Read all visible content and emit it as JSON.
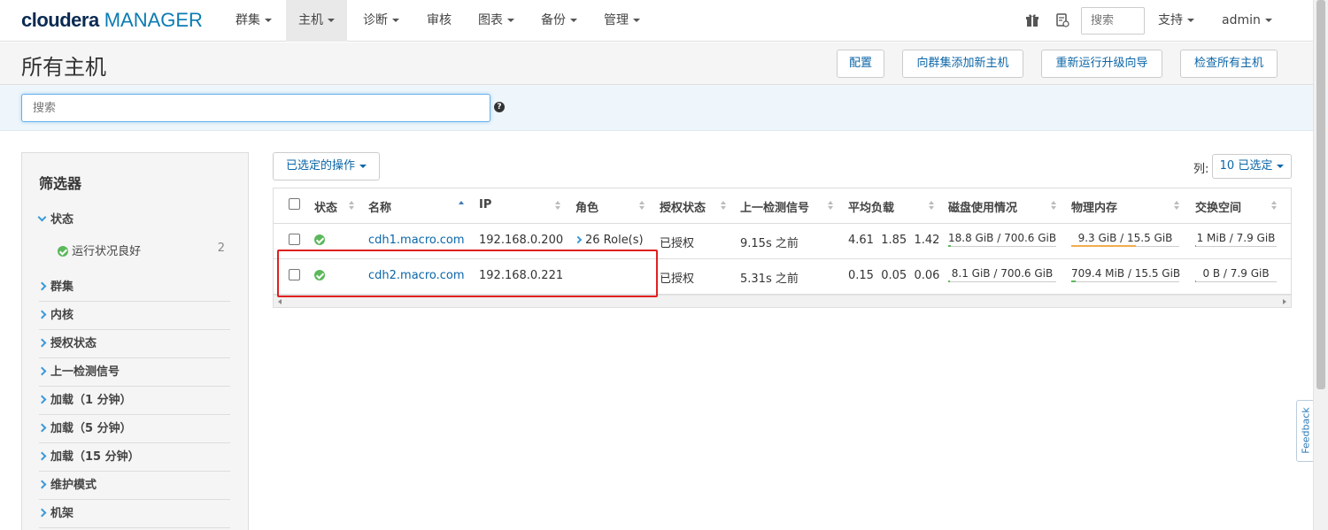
{
  "brand": {
    "name": "cloudera",
    "product": "MANAGER"
  },
  "nav": {
    "items": [
      {
        "label": "群集",
        "dropdown": true
      },
      {
        "label": "主机",
        "dropdown": true,
        "active": true
      },
      {
        "label": "诊断",
        "dropdown": true
      },
      {
        "label": "审核",
        "dropdown": false
      },
      {
        "label": "图表",
        "dropdown": true
      },
      {
        "label": "备份",
        "dropdown": true
      },
      {
        "label": "管理",
        "dropdown": true
      }
    ],
    "search_placeholder": "搜索",
    "support": "支持",
    "user": "admin",
    "icons": [
      "gift-icon",
      "pending-commands-icon"
    ]
  },
  "header": {
    "title": "所有主机",
    "buttons": [
      "配置",
      "向群集添加新主机",
      "重新运行升级向导",
      "检查所有主机"
    ]
  },
  "search": {
    "placeholder": "搜索"
  },
  "filters": {
    "title": "筛选器",
    "status_group": "状态",
    "status_item": {
      "label": "运行状况良好",
      "count": "2"
    },
    "groups": [
      "群集",
      "内核",
      "授权状态",
      "上一检测信号",
      "加载（1 分钟）",
      "加载（5 分钟）",
      "加载（15 分钟）",
      "维护模式",
      "机架"
    ]
  },
  "actions": {
    "selected_ops": "已选定的操作",
    "columns_label": "列:",
    "columns_selected": "10 已选定"
  },
  "table": {
    "headers": [
      "状态",
      "名称",
      "IP",
      "角色",
      "授权状态",
      "上一检测信号",
      "平均负载",
      "磁盘使用情况",
      "物理内存",
      "交换空间"
    ],
    "rows": [
      {
        "status": "good",
        "name": "cdh1.macro.com",
        "ip": "192.168.0.200",
        "roles": "26 Role(s)",
        "auth": "已授权",
        "heartbeat": "9.15s 之前",
        "load": [
          "4.61",
          "1.85",
          "1.42"
        ],
        "disk": "18.8 GiB / 700.6 GiB",
        "disk_frac": 0.027,
        "memory": "9.3 GiB / 15.5 GiB",
        "memory_frac": 0.6,
        "swap": "1 MiB / 7.9 GiB",
        "swap_frac": 0.0
      },
      {
        "status": "good",
        "name": "cdh2.macro.com",
        "ip": "192.168.0.221",
        "roles": "",
        "auth": "已授权",
        "heartbeat": "5.31s 之前",
        "load": [
          "0.15",
          "0.05",
          "0.06"
        ],
        "disk": "8.1 GiB / 700.6 GiB",
        "disk_frac": 0.012,
        "memory": "709.4 MiB / 15.5 GiB",
        "memory_frac": 0.045,
        "swap": "0 B / 7.9 GiB",
        "swap_frac": 0.0
      }
    ]
  },
  "feedback": "Feedback",
  "colors": {
    "link": "#0b66a8",
    "ok": "#5cb85c",
    "highlight": "#e02020",
    "disk_fill": "#5cb85c",
    "memory_fill_high": "#f0ad4e"
  }
}
